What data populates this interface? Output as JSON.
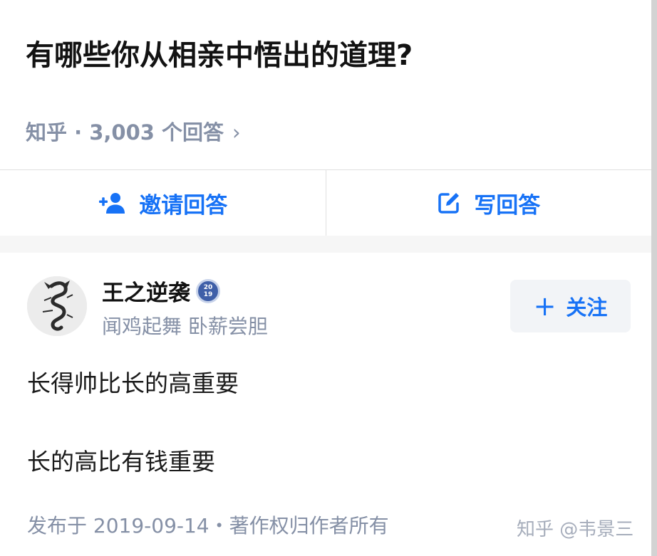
{
  "question": {
    "title": "有哪些你从相亲中悟出的道理?",
    "meta": "知乎 · 3,003 个回答",
    "meta_chevron": "›"
  },
  "actions": {
    "invite_label": "邀请回答",
    "invite_icon": "add-person-icon",
    "write_label": "写回答",
    "write_icon": "edit-icon",
    "accent": "#1772f6"
  },
  "answer": {
    "author": {
      "name": "王之逆袭",
      "badge_text_top": "20",
      "badge_text_bottom": "19",
      "bio": "闻鸡起舞 卧薪尝胆",
      "avatar_icon": "dragon-avatar"
    },
    "follow_label": "关注",
    "follow_plus": "+",
    "paragraphs": [
      "长得帅比长的高重要",
      "长的高比有钱重要"
    ],
    "footer": "发布于 2019-09-14・著作权归作者所有"
  },
  "watermark": "知乎 @韦景三"
}
